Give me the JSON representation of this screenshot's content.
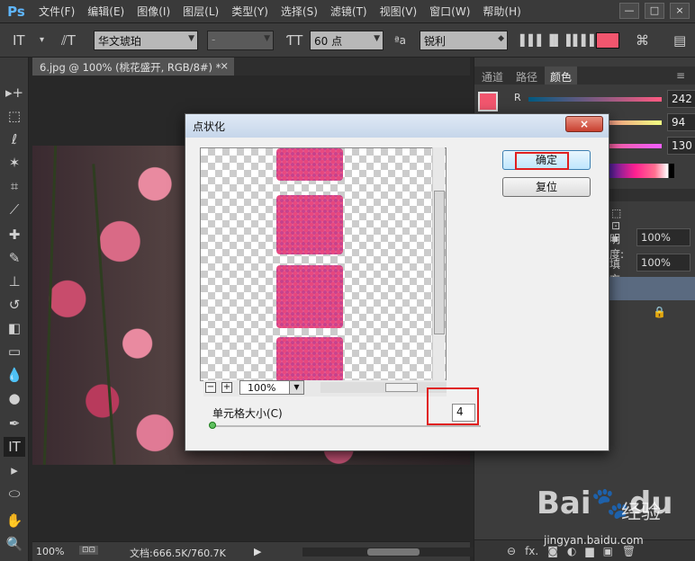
{
  "app": {
    "logo": "Ps"
  },
  "menu": [
    "文件(F)",
    "编辑(E)",
    "图像(I)",
    "图层(L)",
    "类型(Y)",
    "选择(S)",
    "滤镜(T)",
    "视图(V)",
    "窗口(W)",
    "帮助(H)"
  ],
  "window_controls": [
    "—",
    "□",
    "×"
  ],
  "options": {
    "font_family": "华文琥珀",
    "font_style": "-",
    "font_size": "60 点",
    "antialias_label": "ªa",
    "antialias": "锐利",
    "text_color": "#f2566e"
  },
  "document": {
    "tab_title": "6.jpg @ 100% (桃花盛开, RGB/8#) *",
    "tab_close": "×",
    "zoom": "100%",
    "doc_size": "文档:666.5K/760.7K"
  },
  "panels": {
    "tabs": [
      "通道",
      "路径",
      "颜色"
    ],
    "active_tab": "颜色",
    "color": {
      "swatch": "#f2566e",
      "r_label": "R",
      "r": "242",
      "g": "94",
      "b": "130"
    },
    "layers": {
      "opacity_label": "明度:",
      "opacity": "100%",
      "fill_label": "填充:",
      "fill": "100%"
    },
    "footer_icons": [
      "link-icon",
      "fx-icon",
      "mask-icon",
      "adjust-icon",
      "folder-icon",
      "new-layer-icon",
      "trash-icon"
    ],
    "footer_fx": "fx."
  },
  "dialog": {
    "title": "点状化",
    "close": "×",
    "ok": "确定",
    "reset": "复位",
    "zoom": "100%",
    "zoom_minus": "−",
    "zoom_plus": "+",
    "cell_size_label": "单元格大小(C)",
    "cell_size": "4"
  },
  "watermark": {
    "brand": "Bai",
    "brand2": "du",
    "cn": "经验",
    "url": "jingyan.baidu.com"
  }
}
